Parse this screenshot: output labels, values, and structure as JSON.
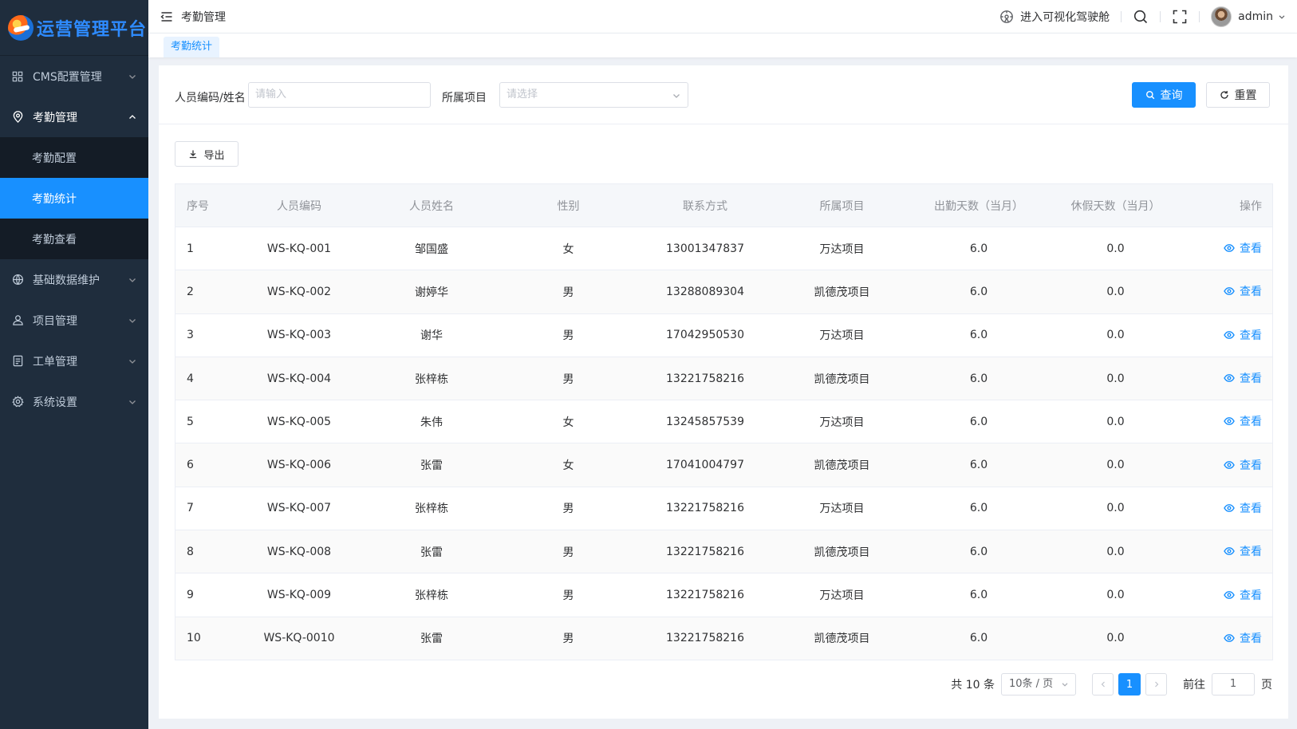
{
  "sidebar": {
    "logo_text": "运营管理平台",
    "menu": [
      {
        "label": "CMS配置管理",
        "icon": "grid-icon"
      },
      {
        "label": "考勤管理",
        "icon": "location-pin-icon",
        "open": true,
        "children": [
          "考勤配置",
          "考勤统计",
          "考勤查看"
        ],
        "active_child": "考勤统计"
      },
      {
        "label": "基础数据维护",
        "icon": "data-icon"
      },
      {
        "label": "项目管理",
        "icon": "user-stack-icon"
      },
      {
        "label": "工单管理",
        "icon": "document-icon"
      },
      {
        "label": "系统设置",
        "icon": "gear-icon"
      }
    ]
  },
  "header": {
    "breadcrumb": "考勤管理",
    "cockpit_link": "进入可视化驾驶舱",
    "username": "admin"
  },
  "tags": {
    "active": "考勤统计"
  },
  "search": {
    "person_label": "人员编码/姓名",
    "person_placeholder": "请输入",
    "project_label": "所属项目",
    "project_placeholder": "请选择",
    "query_label": "查询",
    "reset_label": "重置"
  },
  "toolbar": {
    "export_label": "导出"
  },
  "table": {
    "columns": [
      "序号",
      "人员编码",
      "人员姓名",
      "性别",
      "联系方式",
      "所属项目",
      "出勤天数（当月）",
      "休假天数（当月）",
      "操作"
    ],
    "action_label": "查看",
    "rows": [
      [
        "1",
        "WS-KQ-001",
        "邹国盛",
        "女",
        "13001347837",
        "万达项目",
        "6.0",
        "0.0"
      ],
      [
        "2",
        "WS-KQ-002",
        "谢婷华",
        "男",
        "13288089304",
        "凯德茂项目",
        "6.0",
        "0.0"
      ],
      [
        "3",
        "WS-KQ-003",
        "谢华",
        "男",
        "17042950530",
        "万达项目",
        "6.0",
        "0.0"
      ],
      [
        "4",
        "WS-KQ-004",
        "张梓栋",
        "男",
        "13221758216",
        "凯德茂项目",
        "6.0",
        "0.0"
      ],
      [
        "5",
        "WS-KQ-005",
        "朱伟",
        "女",
        "13245857539",
        "万达项目",
        "6.0",
        "0.0"
      ],
      [
        "6",
        "WS-KQ-006",
        "张雷",
        "女",
        "17041004797",
        "凯德茂项目",
        "6.0",
        "0.0"
      ],
      [
        "7",
        "WS-KQ-007",
        "张梓栋",
        "男",
        "13221758216",
        "万达项目",
        "6.0",
        "0.0"
      ],
      [
        "8",
        "WS-KQ-008",
        "张雷",
        "男",
        "13221758216",
        "凯德茂项目",
        "6.0",
        "0.0"
      ],
      [
        "9",
        "WS-KQ-009",
        "张梓栋",
        "男",
        "13221758216",
        "万达项目",
        "6.0",
        "0.0"
      ],
      [
        "10",
        "WS-KQ-0010",
        "张雷",
        "男",
        "13221758216",
        "凯德茂项目",
        "6.0",
        "0.0"
      ]
    ]
  },
  "pagination": {
    "total_text": "共 10 条",
    "page_size": "10条 / 页",
    "current_page": "1",
    "goto_prefix": "前往",
    "goto_value": "1",
    "goto_suffix": "页"
  },
  "colors": {
    "accent": "#1890ff",
    "sidebar_bg": "#1f2d3d",
    "submenu_bg": "#141c26"
  }
}
